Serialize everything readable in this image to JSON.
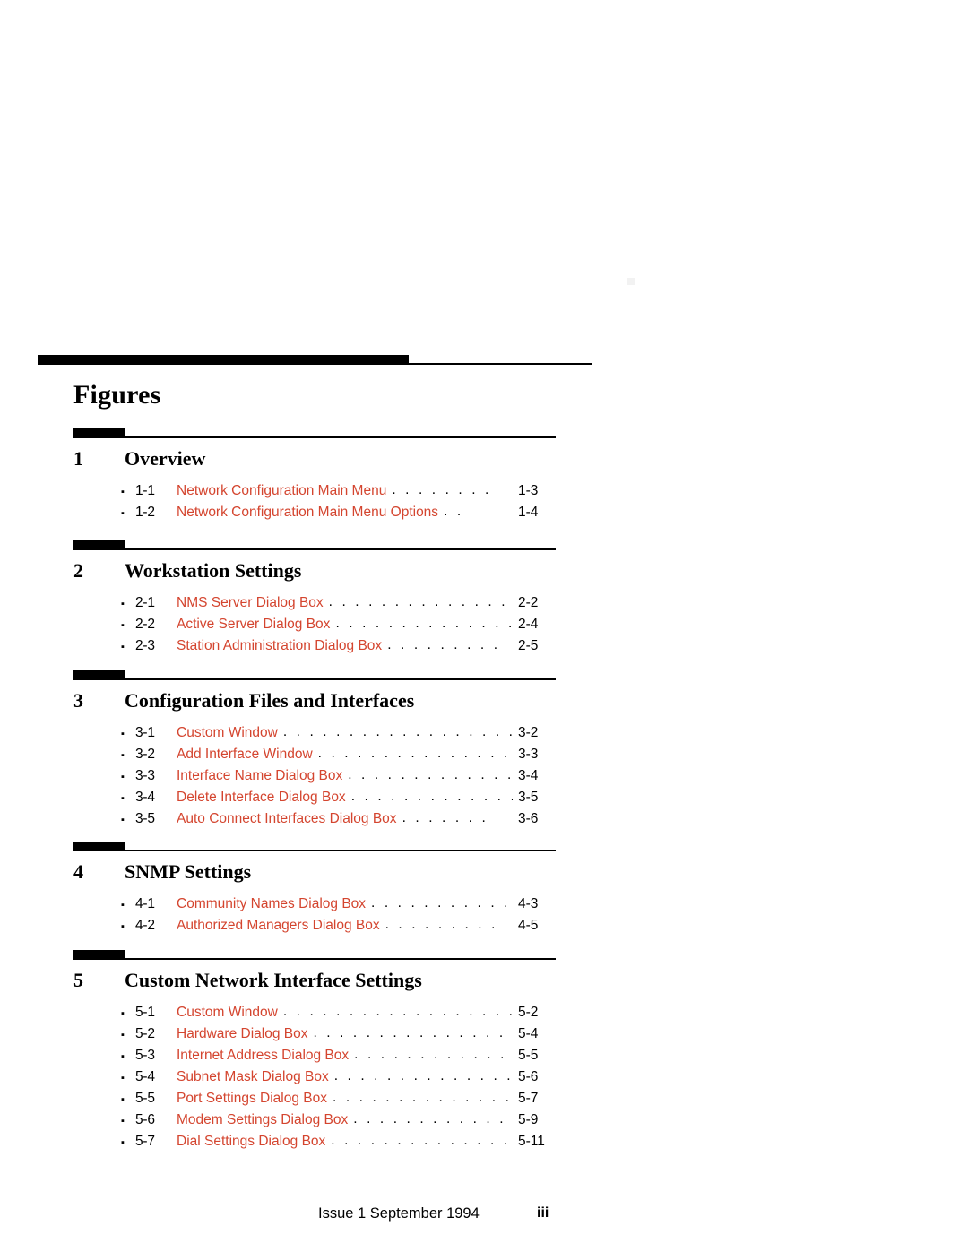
{
  "page": {
    "title": "Figures",
    "footer_text": "Issue 1  September 1994",
    "footer_page": "iii"
  },
  "chapters": [
    {
      "number": "1",
      "title": "Overview",
      "figures": [
        {
          "bullet": "▪",
          "number": "1-1",
          "label": "Network Configuration Main Menu",
          "dots": ". . . . . . . .",
          "page": "1-3"
        },
        {
          "bullet": "▪",
          "number": "1-2",
          "label": "Network Configuration Main Menu Options",
          "dots": ". .",
          "page": "1-4"
        }
      ]
    },
    {
      "number": "2",
      "title": "Workstation Settings",
      "figures": [
        {
          "bullet": "▪",
          "number": "2-1",
          "label": "NMS Server Dialog Box",
          "dots": ". . . . . . . . . . . . . . . .",
          "page": "2-2"
        },
        {
          "bullet": "▪",
          "number": "2-2",
          "label": "Active Server Dialog Box",
          "dots": ". . . . . . . . . . . . . . .",
          "page": "2-4"
        },
        {
          "bullet": "▪",
          "number": "2-3",
          "label": "Station Administration Dialog Box",
          "dots": ". . . . . . . . .",
          "page": "2-5"
        }
      ]
    },
    {
      "number": "3",
      "title": "Configuration Files and Interfaces",
      "figures": [
        {
          "bullet": "▪",
          "number": "3-1",
          "label": "Custom Window",
          "dots": ". . . . . . . . . . . . . . . . . . . . . .",
          "page": "3-2"
        },
        {
          "bullet": "▪",
          "number": "3-2",
          "label": "Add Interface Window",
          "dots": ". . . . . . . . . . . . . . . . . .",
          "page": "3-3"
        },
        {
          "bullet": "▪",
          "number": "3-3",
          "label": "Interface Name Dialog Box",
          "dots": ". . . . . . . . . . . . . .",
          "page": "3-4"
        },
        {
          "bullet": "▪",
          "number": "3-4",
          "label": "Delete Interface Dialog Box",
          "dots": ". . . . . . . . . . . . .",
          "page": "3-5"
        },
        {
          "bullet": "▪",
          "number": "3-5",
          "label": "Auto Connect Interfaces Dialog Box",
          "dots": ". . . . . . .",
          "page": "3-6"
        }
      ]
    },
    {
      "number": "4",
      "title": "SNMP Settings",
      "figures": [
        {
          "bullet": "▪",
          "number": "4-1",
          "label": "Community Names Dialog Box",
          "dots": ". . . . . . . . . . .",
          "page": "4-3"
        },
        {
          "bullet": "▪",
          "number": "4-2",
          "label": "Authorized Managers Dialog Box",
          "dots": ". . . . . . . . .",
          "page": "4-5"
        }
      ]
    },
    {
      "number": "5",
      "title": "Custom Network Interface Settings",
      "figures": [
        {
          "bullet": "▪",
          "number": "5-1",
          "label": "Custom Window",
          "dots": ". . . . . . . . . . . . . . . . . . . . . .",
          "page": "5-2"
        },
        {
          "bullet": "▪",
          "number": "5-2",
          "label": "Hardware Dialog Box",
          "dots": ". . . . . . . . . . . . . . . . . . .",
          "page": "5-4"
        },
        {
          "bullet": "▪",
          "number": "5-3",
          "label": "Internet Address Dialog Box",
          "dots": ". . . . . . . . . . . . . .",
          "page": "5-5"
        },
        {
          "bullet": "▪",
          "number": "5-4",
          "label": "Subnet Mask Dialog Box",
          "dots": ". . . . . . . . . . . . . . . .",
          "page": "5-6"
        },
        {
          "bullet": "▪",
          "number": "5-5",
          "label": "Port Settings Dialog Box",
          "dots": ". . . . . . . . . . . . . . . .",
          "page": "5-7"
        },
        {
          "bullet": "▪",
          "number": "5-6",
          "label": "Modem Settings Dialog Box",
          "dots": ". . . . . . . . . . . . . .",
          "page": "5-9"
        },
        {
          "bullet": "▪",
          "number": "5-7",
          "label": "Dial Settings Dialog Box",
          "dots": ". . . . . . . . . . . . . . . .",
          "page": "5-11"
        }
      ]
    }
  ],
  "colors": {
    "figure_link": "#d4452f",
    "rule": "#000000",
    "text": "#000000"
  },
  "layout": {
    "chapter_tops": [
      478,
      603,
      748,
      939,
      1060
    ]
  }
}
